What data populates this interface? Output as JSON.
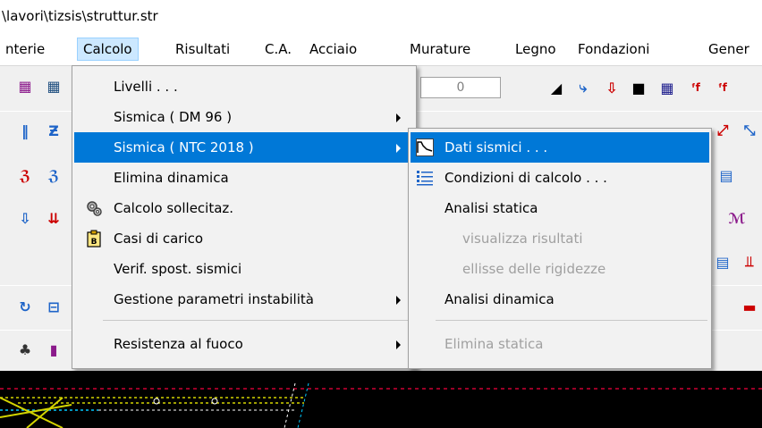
{
  "window": {
    "title": "\\lavori\\tizsis\\struttur.str"
  },
  "menubar": {
    "items": [
      "nterie",
      "Calcolo",
      "Risultati",
      "C.A.",
      "Acciaio",
      "Murature",
      "Legno",
      "Fondazioni",
      "Gener"
    ]
  },
  "toolbar": {
    "field_value": "0"
  },
  "calcolo_menu": {
    "items": [
      {
        "label": "Livelli . . .",
        "submenu": false
      },
      {
        "label": "Sismica ( DM 96 )",
        "submenu": true
      },
      {
        "label": "Sismica ( NTC 2018 )",
        "submenu": true,
        "highlighted": true
      },
      {
        "label": "Elimina dinamica",
        "submenu": false
      },
      {
        "label": "Calcolo sollecitaz.",
        "submenu": false,
        "icon": "gears-icon"
      },
      {
        "label": "Casi di carico",
        "submenu": false,
        "icon": "clipboard-icon"
      },
      {
        "label": "Verif. spost. sismici",
        "submenu": false
      },
      {
        "label": "Gestione parametri instabilità",
        "submenu": true
      },
      {
        "label": "Resistenza al fuoco",
        "submenu": true
      }
    ]
  },
  "ntc_submenu": {
    "items": [
      {
        "label": "Dati sismici . . .",
        "highlighted": true,
        "icon": "spectrum-icon"
      },
      {
        "label": "Condizioni di calcolo . . .",
        "icon": "list-icon"
      },
      {
        "label": "Analisi statica"
      },
      {
        "label": "visualizza risultati",
        "disabled": true
      },
      {
        "label": "ellisse delle rigidezze",
        "disabled": true
      },
      {
        "label": "Analisi dinamica"
      },
      {
        "label": "Elimina statica",
        "disabled": true
      }
    ]
  },
  "colors": {
    "highlight": "#0078d7",
    "menubar_active": "#cce8ff",
    "disabled_text": "#a0a0a0",
    "canvas": "#000000"
  }
}
